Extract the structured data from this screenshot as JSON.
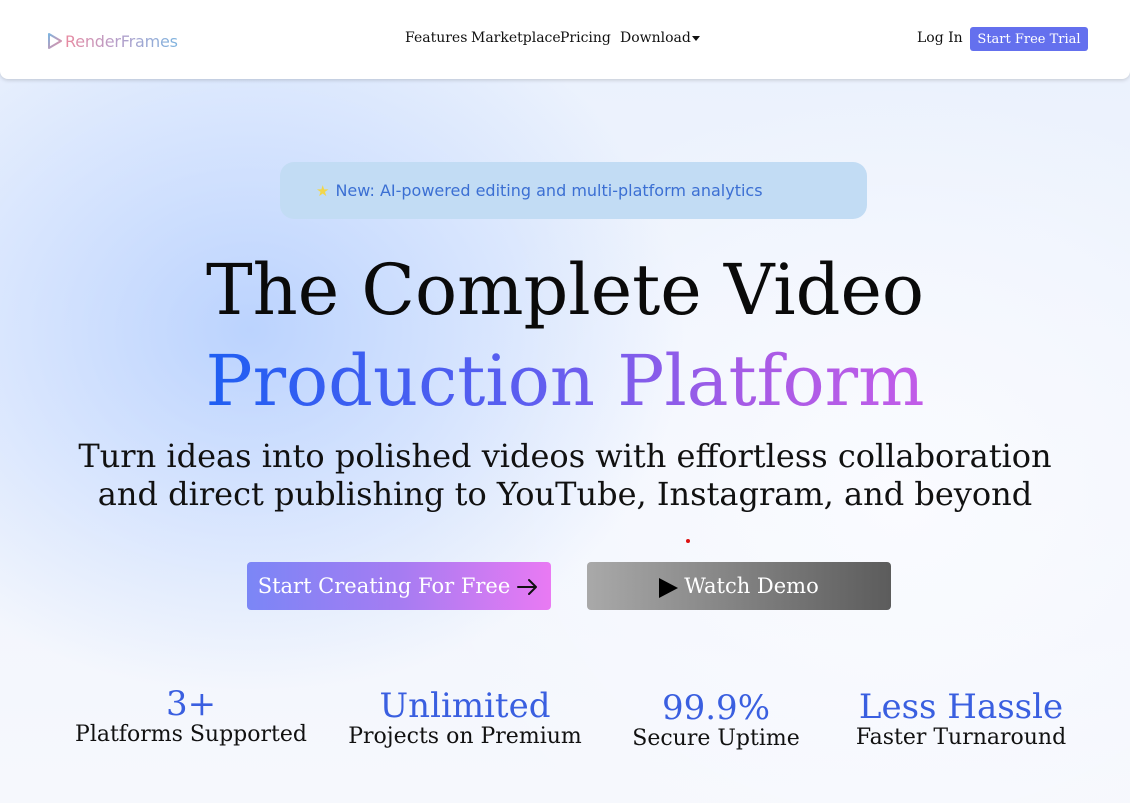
{
  "brand": {
    "name": "RenderFrames",
    "colors": {
      "primary": "#6470ee",
      "accent_blue": "#1f5ef2",
      "accent_purple": "#c25ce8"
    }
  },
  "nav": {
    "links": [
      {
        "label": "Features"
      },
      {
        "label": "Marketplace"
      },
      {
        "label": "Pricing"
      },
      {
        "label": "Download",
        "icon": "caret-down-icon"
      }
    ],
    "login_label": "Log In",
    "trial_label": "Start Free Trial"
  },
  "hero": {
    "badge": {
      "icon": "star-icon",
      "text": "New: AI-powered editing and multi-platform analytics"
    },
    "headline_line1": "The Complete Video",
    "headline_line2": "Production Platform",
    "subtitle_line1": "Turn ideas into polished videos with effortless collaboration",
    "subtitle_line2": "and direct publishing to YouTube, Instagram, and beyond",
    "cta_primary": {
      "label": "Start Creating For Free",
      "icon": "arrow-right-icon"
    },
    "cta_secondary": {
      "label": "Watch Demo",
      "icon": "play-icon"
    }
  },
  "stats": [
    {
      "value": "3+",
      "label": "Platforms Supported"
    },
    {
      "value": "Unlimited",
      "label": "Projects on Premium"
    },
    {
      "value": "99.9%",
      "label": "Secure Uptime"
    },
    {
      "value": "Less Hassle",
      "label": "Faster Turnaround"
    }
  ]
}
